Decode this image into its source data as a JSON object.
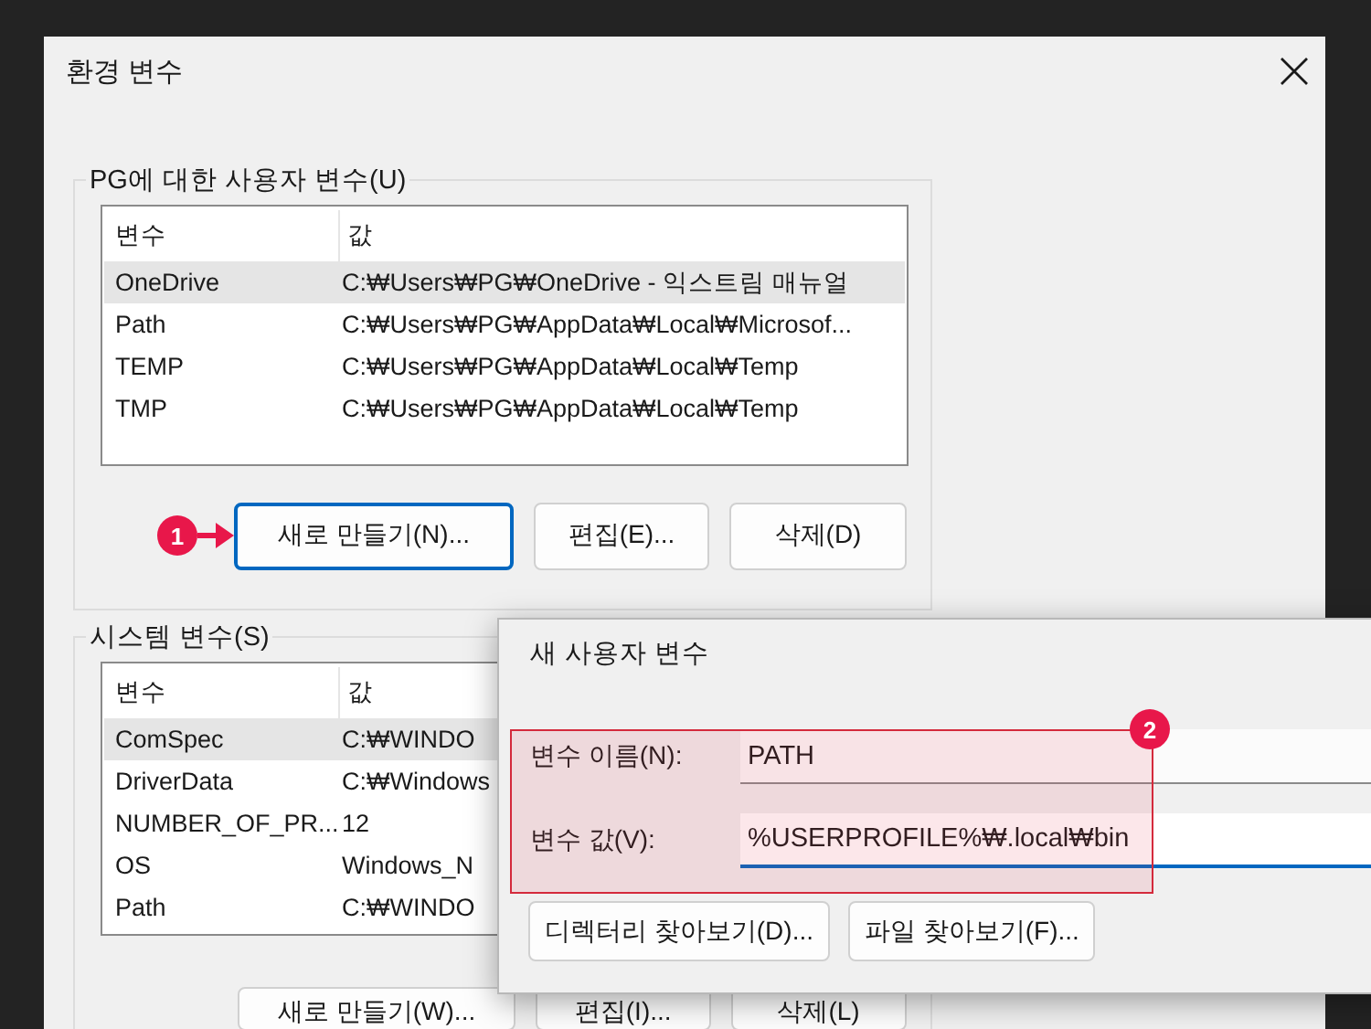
{
  "main_window": {
    "title": "환경 변수"
  },
  "user_variables": {
    "label": "PG에 대한 사용자 변수(U)",
    "columns": [
      "변수",
      "값"
    ],
    "rows": [
      {
        "name": "OneDrive",
        "value": "C:₩Users₩PG₩OneDrive - 익스트림 매뉴얼",
        "selected": true
      },
      {
        "name": "Path",
        "value": "C:₩Users₩PG₩AppData₩Local₩Microsof...",
        "selected": false
      },
      {
        "name": "TEMP",
        "value": "C:₩Users₩PG₩AppData₩Local₩Temp",
        "selected": false
      },
      {
        "name": "TMP",
        "value": "C:₩Users₩PG₩AppData₩Local₩Temp",
        "selected": false
      }
    ],
    "buttons": [
      {
        "label": "새로 만들기(N)...",
        "focused": true
      },
      {
        "label": "편집(E)...",
        "focused": false
      },
      {
        "label": "삭제(D)",
        "focused": false
      }
    ]
  },
  "system_variables": {
    "label": "시스템 변수(S)",
    "columns": [
      "변수",
      "값"
    ],
    "rows": [
      {
        "name": "ComSpec",
        "value": "C:₩WINDO",
        "selected": true
      },
      {
        "name": "DriverData",
        "value": "C:₩Windows",
        "selected": false
      },
      {
        "name": "NUMBER_OF_PR...",
        "value": "12",
        "selected": false
      },
      {
        "name": "OS",
        "value": "Windows_N",
        "selected": false
      },
      {
        "name": "Path",
        "value": "C:₩WINDO",
        "selected": false
      }
    ],
    "buttons": [
      {
        "label": "새로 만들기(W)..."
      },
      {
        "label": "편집(I)..."
      },
      {
        "label": "삭제(L)"
      }
    ]
  },
  "new_variable_dialog": {
    "title": "새 사용자 변수",
    "fields": [
      {
        "label": "변수 이름(N):",
        "value": "PATH",
        "focused": false
      },
      {
        "label": "변수 값(V):",
        "value": "%USERPROFILE%₩.local₩bin",
        "focused": true
      }
    ],
    "buttons": [
      {
        "label": "디렉터리 찾아보기(D)..."
      },
      {
        "label": "파일 찾아보기(F)..."
      }
    ]
  },
  "callouts": [
    {
      "number": "1"
    },
    {
      "number": "2"
    }
  ]
}
